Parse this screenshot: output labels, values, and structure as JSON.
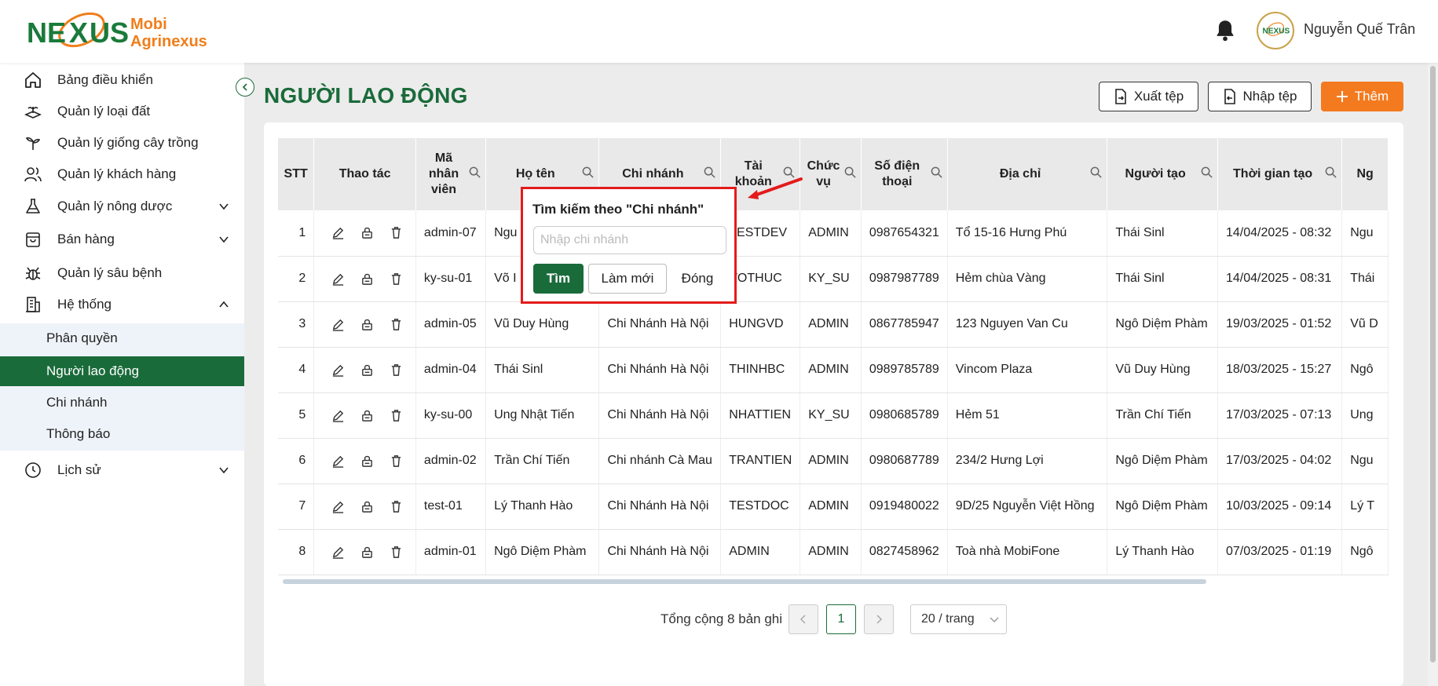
{
  "brand": {
    "line1": "Mobi",
    "line2": "Agrinexus",
    "logo_text": "NEXUS"
  },
  "header": {
    "user_name": "Nguyễn Quế Trân",
    "avatar_text": "NEXUS"
  },
  "sidebar": {
    "items": [
      {
        "label": "Bảng điều khiển",
        "icon": "home-icon"
      },
      {
        "label": "Quản lý loại đất",
        "icon": "soil-icon"
      },
      {
        "label": "Quản lý giống cây trồng",
        "icon": "plant-icon"
      },
      {
        "label": "Quản lý khách hàng",
        "icon": "users-icon"
      },
      {
        "label": "Quản lý nông dược",
        "icon": "flask-icon"
      },
      {
        "label": "Bán hàng",
        "icon": "bag-icon"
      },
      {
        "label": "Quản lý sâu bệnh",
        "icon": "bug-icon"
      },
      {
        "label": "Hệ thống",
        "icon": "building-icon"
      },
      {
        "label": "Lịch sử",
        "icon": "clock-icon"
      }
    ],
    "sub_items": [
      "Phân quyền",
      "Người lao động",
      "Chi nhánh",
      "Thông báo"
    ]
  },
  "page": {
    "title": "NGƯỜI LAO ĐỘNG",
    "export_label": "Xuất tệp",
    "import_label": "Nhập tệp",
    "add_label": "Thêm"
  },
  "table": {
    "headers": [
      "STT",
      "Thao tác",
      "Mã nhân viên",
      "Họ tên",
      "Chi nhánh",
      "Tài khoản",
      "Chức vụ",
      "Số điện thoại",
      "Địa chỉ",
      "Người tạo",
      "Thời gian tạo",
      "Ng"
    ],
    "rows": [
      [
        "1",
        "admin-07",
        "Ngu",
        "",
        "TESTDEV",
        "ADMIN",
        "0987654321",
        "Tổ 15-16 Hưng Phú",
        "Thái Sinl",
        "14/04/2025 - 08:32",
        "Ngu"
      ],
      [
        "2",
        "ky-su-01",
        "Võ I",
        "",
        "VOTHUC",
        "KY_SU",
        "0987987789",
        "Hẻm chùa Vàng",
        "Thái Sinl",
        "14/04/2025 - 08:31",
        "Thái"
      ],
      [
        "3",
        "admin-05",
        "Vũ Duy Hùng",
        "Chi Nhánh Hà Nội",
        "HUNGVD",
        "ADMIN",
        "0867785947",
        "123 Nguyen Van Cu",
        "Ngô Diệm Phàm",
        "19/03/2025 - 01:52",
        "Vũ D"
      ],
      [
        "4",
        "admin-04",
        "Thái Sinl",
        "Chi Nhánh Hà Nội",
        "THINHBC",
        "ADMIN",
        "0989785789",
        "Vincom Plaza",
        "Vũ Duy Hùng",
        "18/03/2025 - 15:27",
        "Ngô"
      ],
      [
        "5",
        "ky-su-00",
        "Ung Nhật Tiến",
        "Chi Nhánh Hà Nội",
        "NHATTIEN",
        "KY_SU",
        "0980685789",
        "Hẻm 51",
        "Trần Chí Tiến",
        "17/03/2025 - 07:13",
        "Ung"
      ],
      [
        "6",
        "admin-02",
        "Trần Chí Tiến",
        "Chi nhánh Cà Mau",
        "TRANTIEN",
        "ADMIN",
        "0980687789",
        "234/2 Hưng Lợi",
        "Ngô Diệm Phàm",
        "17/03/2025 - 04:02",
        "Ngu"
      ],
      [
        "7",
        "test-01",
        "Lý Thanh Hào",
        "Chi Nhánh Hà Nội",
        "TESTDOC",
        "ADMIN",
        "0919480022",
        "9D/25 Nguyễn Việt Hồng",
        "Ngô Diệm Phàm",
        "10/03/2025 - 09:14",
        "Lý T"
      ],
      [
        "8",
        "admin-01",
        "Ngô Diệm Phàm",
        "Chi Nhánh Hà Nội",
        "ADMIN",
        "ADMIN",
        "0827458962",
        "Toà nhà MobiFone",
        "Lý Thanh Hào",
        "07/03/2025 - 01:19",
        "Ngô"
      ]
    ]
  },
  "pagination": {
    "total": "Tổng cộng 8 bản ghi",
    "current": "1",
    "page_size": "20 / trang"
  },
  "popup": {
    "title": "Tìm kiếm theo \"Chi nhánh\"",
    "placeholder": "Nhập chi nhánh",
    "value": "",
    "find_label": "Tìm",
    "reset_label": "Làm mới",
    "close_label": "Đóng"
  },
  "colors": {
    "primary": "#1a6b3a",
    "accent": "#f47a1f",
    "highlight": "#e31b1b"
  }
}
